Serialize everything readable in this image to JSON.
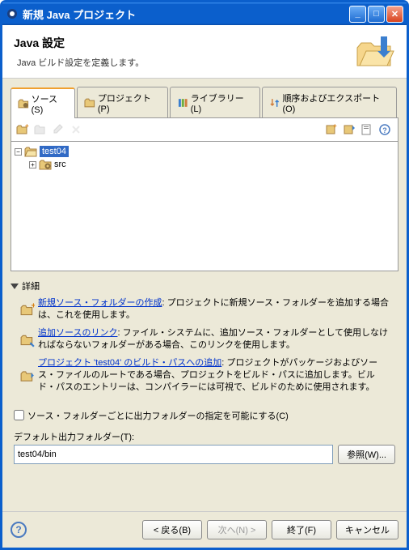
{
  "window": {
    "title": "新規 Java プロジェクト"
  },
  "header": {
    "title": "Java 設定",
    "desc": "Java ビルド設定を定義します。"
  },
  "tabs": {
    "source": "ソース(S)",
    "projects": "プロジェクト(P)",
    "libraries": "ライブラリー(L)",
    "order": "順序およびエクスポート(O)"
  },
  "tree": {
    "root": "test04",
    "child": "src"
  },
  "details": {
    "header": "詳細",
    "item1_link": "新規ソース・フォルダーの作成",
    "item1_text": ": プロジェクトに新規ソース・フォルダーを追加する場合は、これを使用します。",
    "item2_link": "追加ソースのリンク",
    "item2_text": ": ファイル・システムに、追加ソース・フォルダーとして使用しなければならないフォルダーがある場合、このリンクを使用します。",
    "item3_link": "プロジェクト 'test04' のビルド・パスへの追加",
    "item3_text": ": プロジェクトがパッケージおよびソース・ファイルのルートである場合、プロジェクトをビルド・パスに追加します。ビルド・パスのエントリーは、コンパイラーには可視で、ビルドのために使用されます。"
  },
  "checkbox": {
    "label": "ソース・フォルダーごとに出力フォルダーの指定を可能にする(C)"
  },
  "output": {
    "label": "デフォルト出力フォルダー(T):",
    "value": "test04/bin",
    "browse": "参照(W)..."
  },
  "footer": {
    "back": "< 戻る(B)",
    "next": "次へ(N) >",
    "finish": "終了(F)",
    "cancel": "キャンセル"
  }
}
